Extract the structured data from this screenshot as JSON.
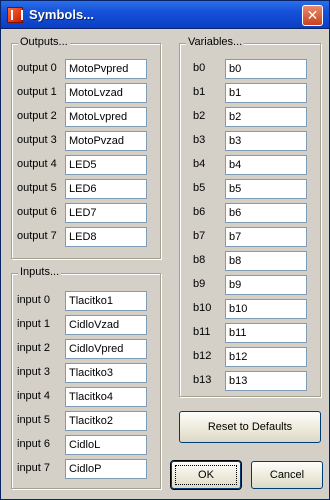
{
  "window": {
    "title": "Symbols..."
  },
  "outputs": {
    "label": "Outputs...",
    "items": [
      {
        "label": "output 0",
        "value": "MotoPvpred"
      },
      {
        "label": "output 1",
        "value": "MotoLvzad"
      },
      {
        "label": "output 2",
        "value": "MotoLvpred"
      },
      {
        "label": "output 3",
        "value": "MotoPvzad"
      },
      {
        "label": "output 4",
        "value": "LED5"
      },
      {
        "label": "output 5",
        "value": "LED6"
      },
      {
        "label": "output 6",
        "value": "LED7"
      },
      {
        "label": "output 7",
        "value": "LED8"
      }
    ]
  },
  "inputs": {
    "label": "Inputs...",
    "items": [
      {
        "label": "input 0",
        "value": "Tlacitko1"
      },
      {
        "label": "input 1",
        "value": "CidloVzad"
      },
      {
        "label": "input 2",
        "value": "CidloVpred"
      },
      {
        "label": "input 3",
        "value": "Tlacitko3"
      },
      {
        "label": "input 4",
        "value": "Tlacitko4"
      },
      {
        "label": "input 5",
        "value": "Tlacitko2"
      },
      {
        "label": "input 6",
        "value": "CidloL"
      },
      {
        "label": "input 7",
        "value": "CidloP"
      }
    ]
  },
  "variables": {
    "label": "Variables...",
    "items": [
      {
        "label": "b0",
        "value": "b0"
      },
      {
        "label": "b1",
        "value": "b1"
      },
      {
        "label": "b2",
        "value": "b2"
      },
      {
        "label": "b3",
        "value": "b3"
      },
      {
        "label": "b4",
        "value": "b4"
      },
      {
        "label": "b5",
        "value": "b5"
      },
      {
        "label": "b6",
        "value": "b6"
      },
      {
        "label": "b7",
        "value": "b7"
      },
      {
        "label": "b8",
        "value": "b8"
      },
      {
        "label": "b9",
        "value": "b9"
      },
      {
        "label": "b10",
        "value": "b10"
      },
      {
        "label": "b11",
        "value": "b11"
      },
      {
        "label": "b12",
        "value": "b12"
      },
      {
        "label": "b13",
        "value": "b13"
      }
    ]
  },
  "buttons": {
    "reset": "Reset to Defaults",
    "ok": "OK",
    "cancel": "Cancel"
  }
}
